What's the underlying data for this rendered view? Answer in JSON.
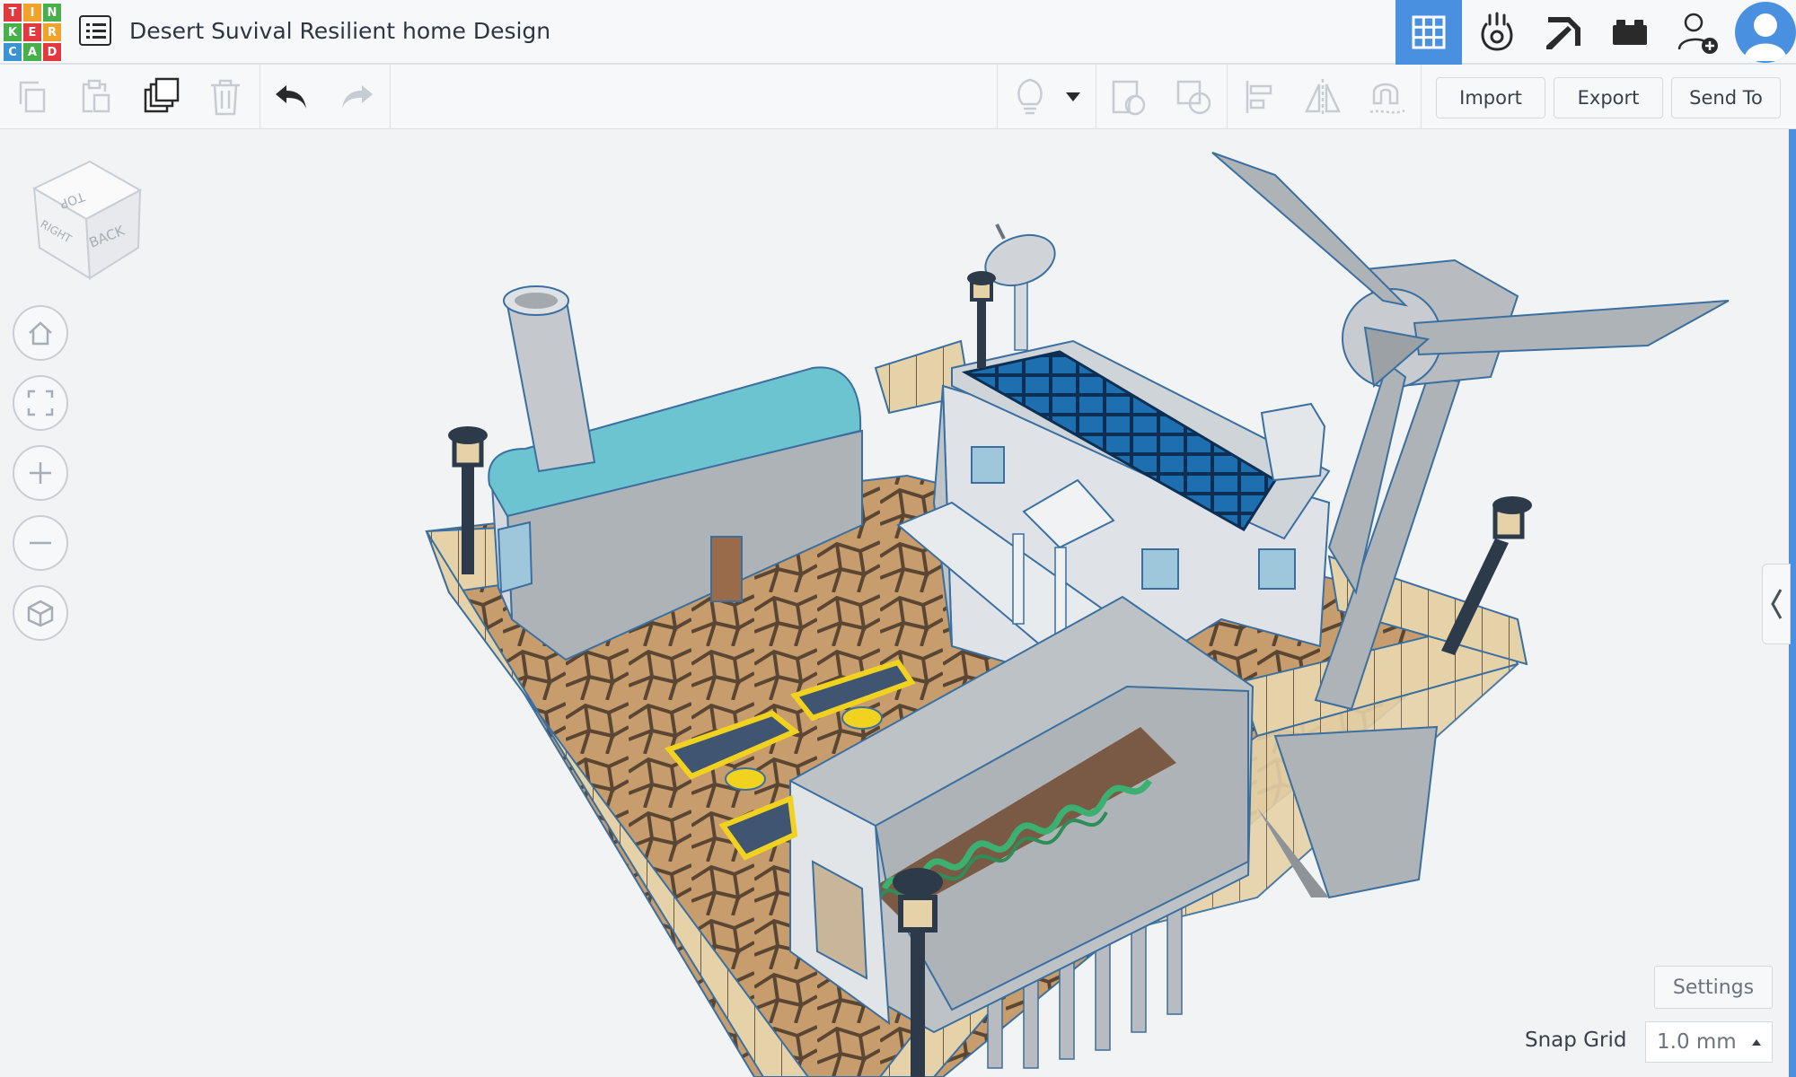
{
  "app": {
    "logo_letters": [
      "T",
      "I",
      "N",
      "K",
      "E",
      "R",
      "C",
      "A",
      "D"
    ],
    "logo_colors": [
      "#e2383f",
      "#f0a22b",
      "#48b04b",
      "#48b04b",
      "#e2383f",
      "#f0a22b",
      "#3a94d4",
      "#48b04b",
      "#e2383f"
    ],
    "design_title": "Desert Suvival Resilient home Design"
  },
  "header_icons": [
    {
      "name": "3d-design-grid-icon",
      "active": true
    },
    {
      "name": "circuits-icon",
      "active": false
    },
    {
      "name": "minecraft-pickaxe-icon",
      "active": false
    },
    {
      "name": "bricks-icon",
      "active": false
    },
    {
      "name": "add-user-icon",
      "active": false
    },
    {
      "name": "user-avatar-icon",
      "active": false
    }
  ],
  "toolbar": {
    "left_tools": [
      "copy-icon",
      "paste-icon",
      "duplicate-icon",
      "delete-icon",
      "undo-icon",
      "redo-icon"
    ],
    "right_tools": [
      "light-bulb-icon",
      "dropdown-caret-icon",
      "group-icon",
      "ungroup-icon",
      "align-icon",
      "mirror-icon",
      "cruise-magnet-icon"
    ],
    "import_label": "Import",
    "export_label": "Export",
    "send_to_label": "Send To"
  },
  "view_cube": {
    "top_label": "TOP",
    "right_label": "RIGHT",
    "back_label": "BACK"
  },
  "nav_controls": [
    "home-view-icon",
    "fit-view-icon",
    "zoom-in-icon",
    "zoom-out-icon",
    "perspective-toggle-icon"
  ],
  "footer": {
    "settings_label": "Settings",
    "snap_grid_label": "Snap Grid",
    "snap_grid_value": "1.0 mm"
  },
  "colors": {
    "accent": "#4a90e0",
    "roof_teal": "#6cc4d0",
    "solar_blue": "#1e6fb0",
    "floor_tan": "#c8a070",
    "fence_beige": "#e3cfa4",
    "stone_path": "#8a6a48",
    "bed_yellow": "#f1d31f"
  }
}
